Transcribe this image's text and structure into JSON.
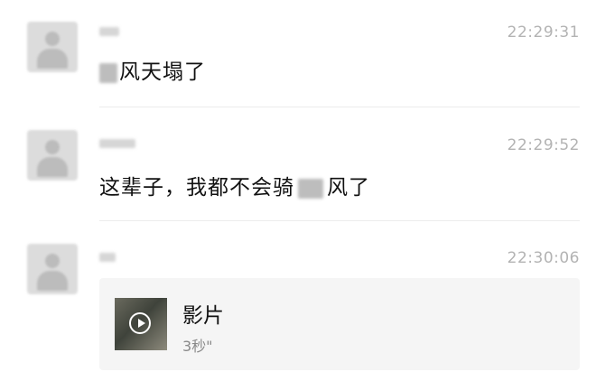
{
  "messages": [
    {
      "time": "22:29:31",
      "text_after_redaction": "风天塌了"
    },
    {
      "time": "22:29:52",
      "text_before_redaction": "这辈子，我都不会骑",
      "text_after_redaction": "风了"
    },
    {
      "time": "22:30:06",
      "video": {
        "title": "影片",
        "duration": "3秒\""
      }
    }
  ],
  "icons": {
    "avatar": "default-avatar-icon",
    "play": "play-icon"
  }
}
